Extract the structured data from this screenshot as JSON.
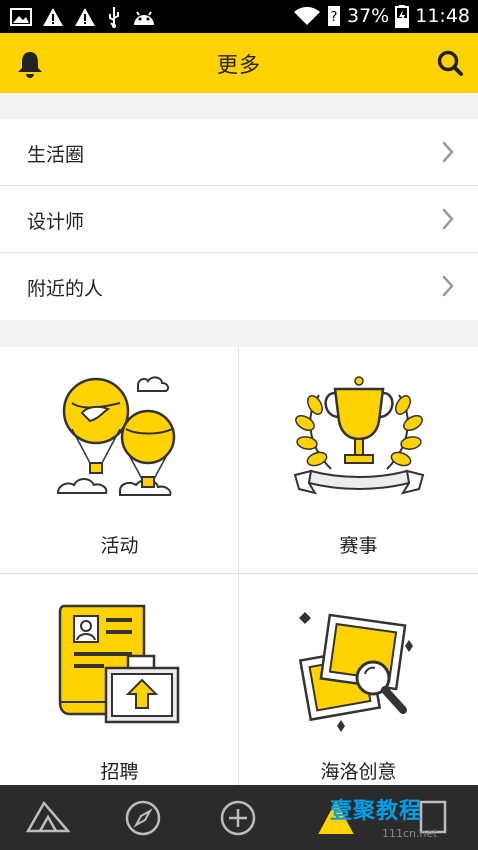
{
  "status_bar": {
    "battery_percent": "37%",
    "time": "11:48"
  },
  "header": {
    "title": "更多"
  },
  "menu": {
    "items": [
      {
        "label": "生活圈"
      },
      {
        "label": "设计师"
      },
      {
        "label": "附近的人"
      }
    ]
  },
  "grid": {
    "tiles": [
      {
        "label": "活动"
      },
      {
        "label": "赛事"
      },
      {
        "label": "招聘"
      },
      {
        "label": "海洛创意"
      }
    ]
  },
  "watermark": {
    "text": "壹聚教程",
    "sub": "111cn.net"
  },
  "colors": {
    "accent": "#ffd200",
    "dark": "#2b2b2b",
    "divider": "#e0e0e0"
  }
}
